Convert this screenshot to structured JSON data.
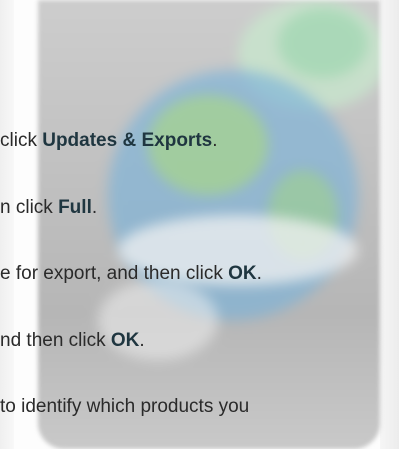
{
  "steps": [
    {
      "before": "click ",
      "bold": "Updates & Exports",
      "after": "."
    },
    {
      "before": "n click ",
      "bold": "Full",
      "after": "."
    },
    {
      "before": "e for export, and then click ",
      "bold": "OK",
      "after": "."
    },
    {
      "before": "nd then click ",
      "bold": "OK",
      "after": "."
    },
    {
      "before": "to identify which products you",
      "bold": "",
      "after": ""
    }
  ],
  "background_icon": "globe-application-icon"
}
